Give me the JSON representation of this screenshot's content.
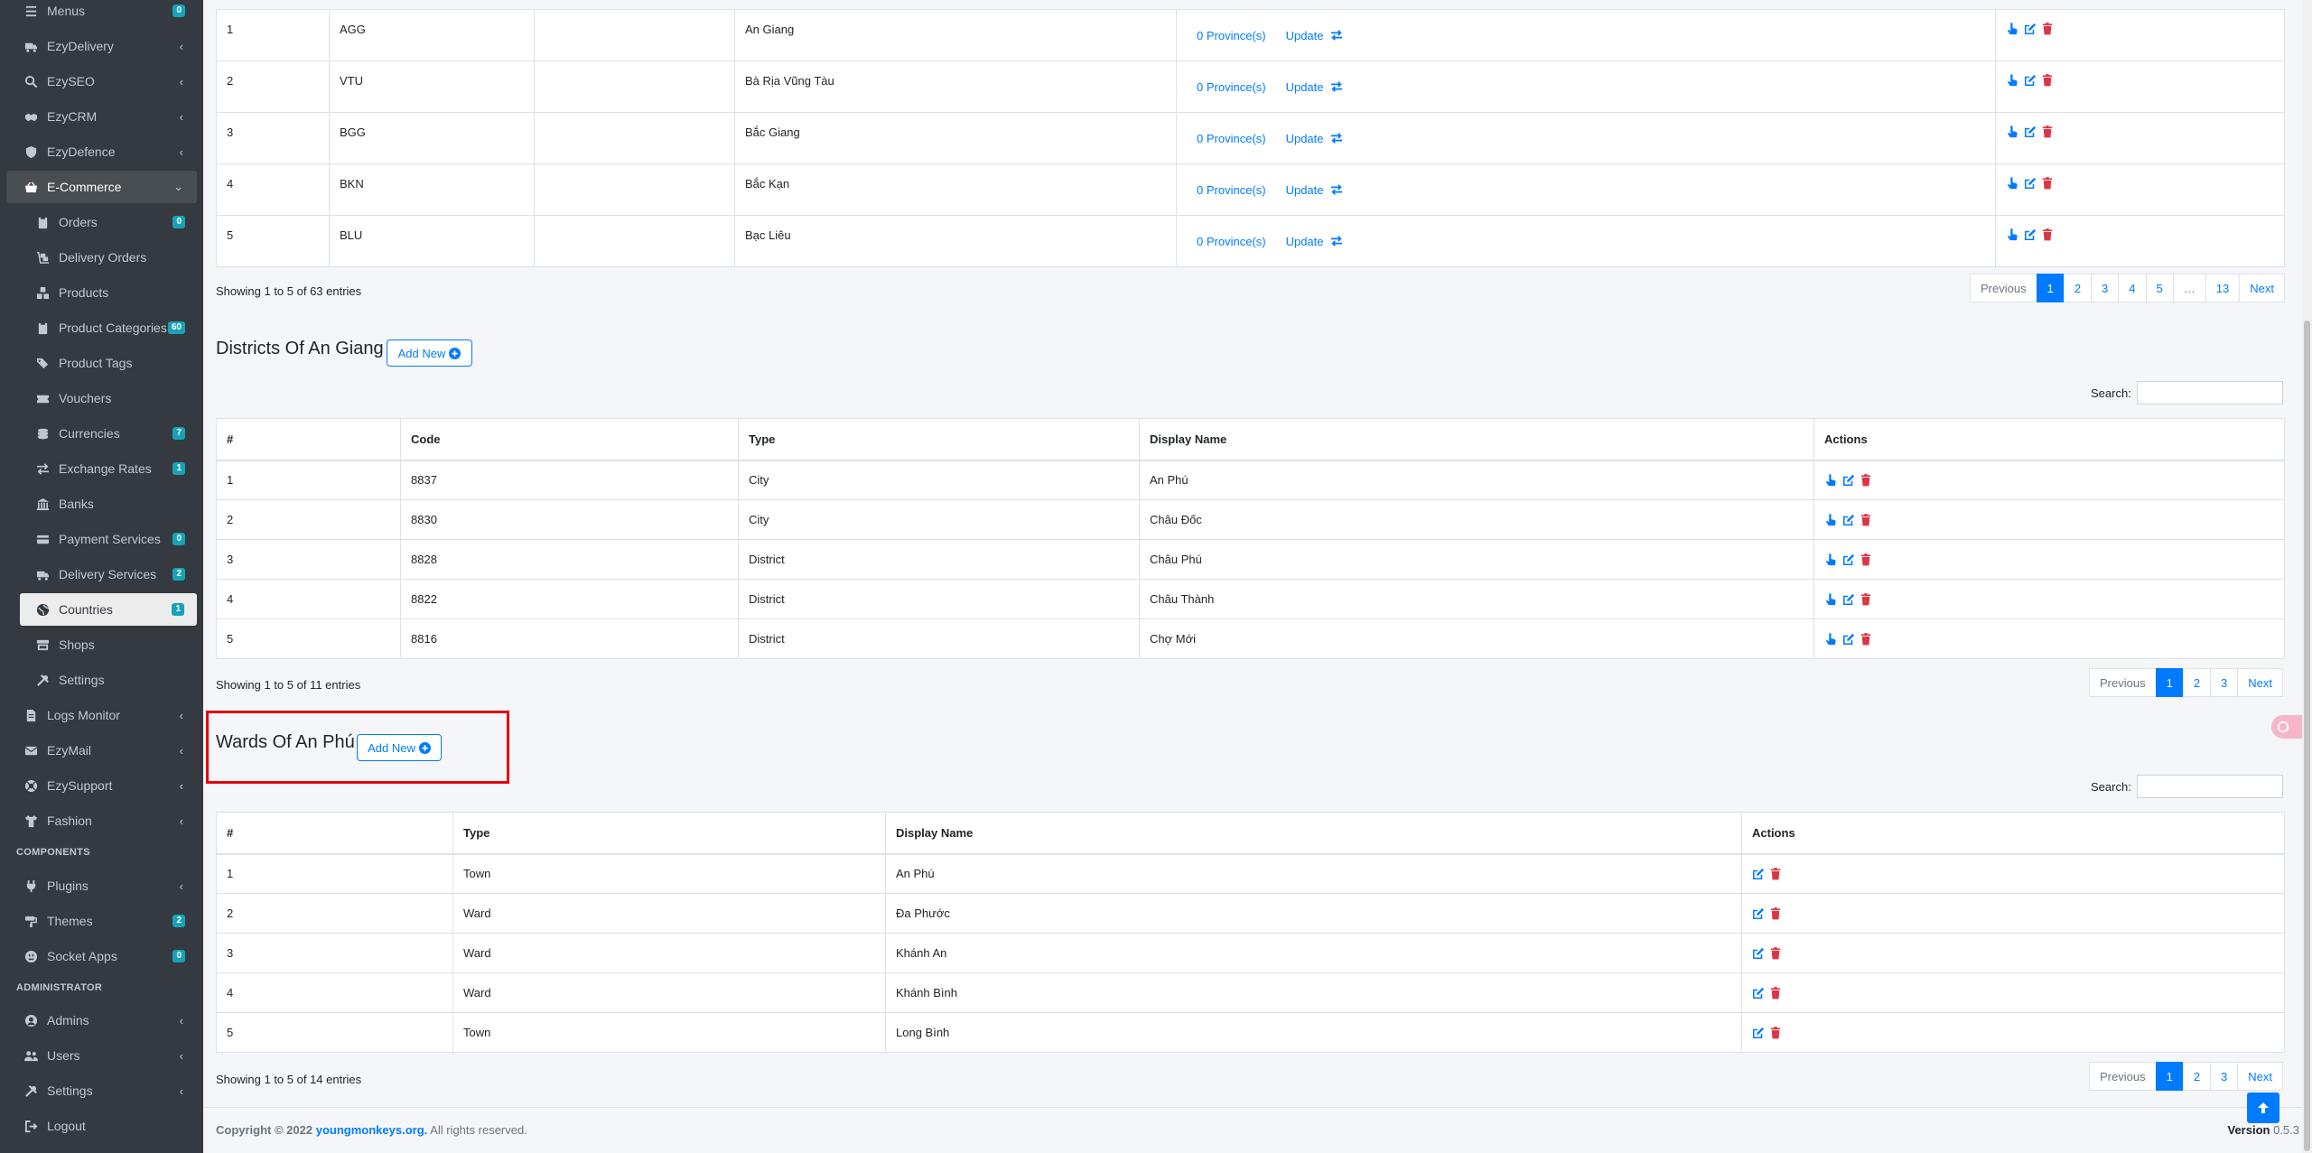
{
  "sidebar": {
    "items": [
      {
        "label": "Menus",
        "icon": "menu-icon",
        "badge": "0"
      },
      {
        "label": "EzyDelivery",
        "icon": "truck-icon",
        "chevron": "‹"
      },
      {
        "label": "EzySEO",
        "icon": "search-icon",
        "chevron": "‹"
      },
      {
        "label": "EzyCRM",
        "icon": "handshake-icon",
        "chevron": "‹"
      },
      {
        "label": "EzyDefence",
        "icon": "shield-icon",
        "chevron": "‹"
      },
      {
        "label": "E-Commerce",
        "icon": "basket-icon",
        "chevron": "⌄"
      },
      {
        "label": "Orders",
        "icon": "clipboard-icon",
        "badge": "0"
      },
      {
        "label": "Delivery Orders",
        "icon": "dolly-icon"
      },
      {
        "label": "Products",
        "icon": "boxes-icon"
      },
      {
        "label": "Product Categories",
        "icon": "clipboard-icon",
        "badge": "60"
      },
      {
        "label": "Product Tags",
        "icon": "tags-icon"
      },
      {
        "label": "Vouchers",
        "icon": "ticket-icon"
      },
      {
        "label": "Currencies",
        "icon": "coins-icon",
        "badge": "7"
      },
      {
        "label": "Exchange Rates",
        "icon": "exchange-icon",
        "badge": "1"
      },
      {
        "label": "Banks",
        "icon": "bank-icon"
      },
      {
        "label": "Payment Services",
        "icon": "credit-card-icon",
        "badge": "0"
      },
      {
        "label": "Delivery Services",
        "icon": "truck-icon",
        "badge": "2"
      },
      {
        "label": "Countries",
        "icon": "globe-icon",
        "badge": "1"
      },
      {
        "label": "Shops",
        "icon": "store-icon"
      },
      {
        "label": "Settings",
        "icon": "tools-icon"
      },
      {
        "label": "Logs Monitor",
        "icon": "file-icon",
        "chevron": "‹"
      },
      {
        "label": "EzyMail",
        "icon": "envelope-icon",
        "chevron": "‹"
      },
      {
        "label": "EzySupport",
        "icon": "support-icon",
        "chevron": "‹"
      },
      {
        "label": "Fashion",
        "icon": "shirt-icon",
        "chevron": "‹"
      },
      {
        "label": "Plugins",
        "icon": "plug-icon",
        "chevron": "‹"
      },
      {
        "label": "Themes",
        "icon": "paint-icon",
        "badge": "2"
      },
      {
        "label": "Socket Apps",
        "icon": "socket-icon",
        "badge": "0"
      },
      {
        "label": "Admins",
        "icon": "user-circle-icon",
        "chevron": "‹"
      },
      {
        "label": "Users",
        "icon": "users-icon",
        "chevron": "‹"
      },
      {
        "label": "Settings",
        "icon": "tools-icon",
        "chevron": "‹"
      },
      {
        "label": "Logout",
        "icon": "logout-icon"
      }
    ],
    "headers": {
      "components": "COMPONENTS",
      "administrator": "ADMINISTRATOR"
    }
  },
  "provinces": {
    "rows": [
      {
        "num": "1",
        "code": "AGG",
        "name": "An Giang",
        "link": "0 Province(s)",
        "update": "Update"
      },
      {
        "num": "2",
        "code": "VTU",
        "name": "Bà Rịa Vũng Tàu",
        "link": "0 Province(s)",
        "update": "Update"
      },
      {
        "num": "3",
        "code": "BGG",
        "name": "Bắc Giang",
        "link": "0 Province(s)",
        "update": "Update"
      },
      {
        "num": "4",
        "code": "BKN",
        "name": "Bắc Kạn",
        "link": "0 Province(s)",
        "update": "Update"
      },
      {
        "num": "5",
        "code": "BLU",
        "name": "Bạc Liêu",
        "link": "0 Province(s)",
        "update": "Update"
      }
    ],
    "info": "Showing 1 to 5 of 63 entries",
    "pager": [
      "Previous",
      "1",
      "2",
      "3",
      "4",
      "5",
      "…",
      "13",
      "Next"
    ]
  },
  "districts": {
    "title": "Districts Of An Giang",
    "add_label": "Add New",
    "search_label": "Search:",
    "headers": [
      "#",
      "Code",
      "Type",
      "Display Name",
      "Actions"
    ],
    "rows": [
      {
        "num": "1",
        "code": "8837",
        "type": "City",
        "name": "An Phú"
      },
      {
        "num": "2",
        "code": "8830",
        "type": "City",
        "name": "Châu Đốc"
      },
      {
        "num": "3",
        "code": "8828",
        "type": "District",
        "name": "Châu Phú"
      },
      {
        "num": "4",
        "code": "8822",
        "type": "District",
        "name": "Châu Thành"
      },
      {
        "num": "5",
        "code": "8816",
        "type": "District",
        "name": "Chợ Mới"
      }
    ],
    "info": "Showing 1 to 5 of 11 entries",
    "pager": [
      "Previous",
      "1",
      "2",
      "3",
      "Next"
    ]
  },
  "wards": {
    "title": "Wards Of An Phú",
    "add_label": "Add New",
    "search_label": "Search:",
    "headers": [
      "#",
      "Type",
      "Display Name",
      "Actions"
    ],
    "rows": [
      {
        "num": "1",
        "type": "Town",
        "name": "An Phú"
      },
      {
        "num": "2",
        "type": "Ward",
        "name": "Đa Phước"
      },
      {
        "num": "3",
        "type": "Ward",
        "name": "Khánh An"
      },
      {
        "num": "4",
        "type": "Ward",
        "name": "Khánh Bình"
      },
      {
        "num": "5",
        "type": "Town",
        "name": "Long Bình"
      }
    ],
    "info": "Showing 1 to 5 of 14 entries",
    "pager": [
      "Previous",
      "1",
      "2",
      "3",
      "Next"
    ]
  },
  "footer": {
    "copyright": "Copyright © 2022",
    "link": "youngmonkeys.org.",
    "rights": "All rights reserved.",
    "version_label": "Version",
    "version": "0.5.3"
  },
  "colors": {
    "accent": "#007bff",
    "danger": "#dc3545",
    "badge": "#17a2b8",
    "sidebar": "#343a40",
    "highlight": "#e3000f"
  }
}
